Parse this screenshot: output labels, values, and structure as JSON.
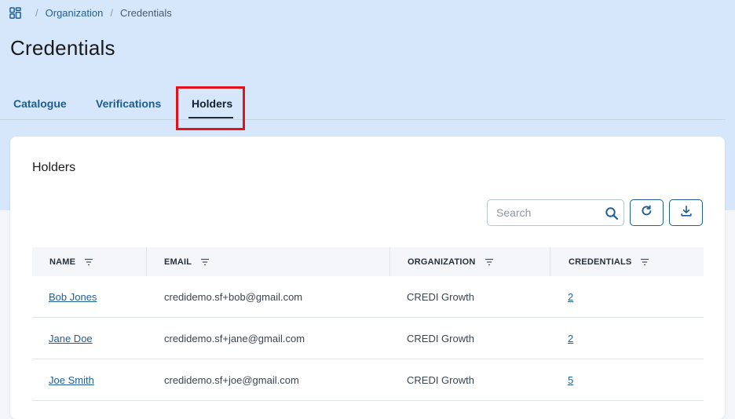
{
  "breadcrumb": {
    "items": [
      "Organization",
      "Credentials"
    ]
  },
  "page": {
    "title": "Credentials"
  },
  "tabs": [
    {
      "label": "Catalogue",
      "active": false
    },
    {
      "label": "Verifications",
      "active": false
    },
    {
      "label": "Holders",
      "active": true
    }
  ],
  "card": {
    "title": "Holders",
    "search_placeholder": "Search"
  },
  "table": {
    "columns": [
      "NAME",
      "EMAIL",
      "ORGANIZATION",
      "CREDENTIALS"
    ],
    "rows": [
      {
        "name": "Bob Jones",
        "email": "credidemo.sf+bob@gmail.com",
        "organization": "CREDI Growth",
        "credentials": "2"
      },
      {
        "name": "Jane Doe",
        "email": "credidemo.sf+jane@gmail.com",
        "organization": "CREDI Growth",
        "credentials": "2"
      },
      {
        "name": "Joe Smith",
        "email": "credidemo.sf+joe@gmail.com",
        "organization": "CREDI Growth",
        "credentials": "5"
      }
    ]
  },
  "colors": {
    "hero_bg": "#d6e7fb",
    "accent": "#1e5f95",
    "highlight": "#e0121c"
  },
  "icons": [
    "dashboard-icon",
    "search-icon",
    "refresh-icon",
    "download-icon",
    "filter-icon"
  ]
}
